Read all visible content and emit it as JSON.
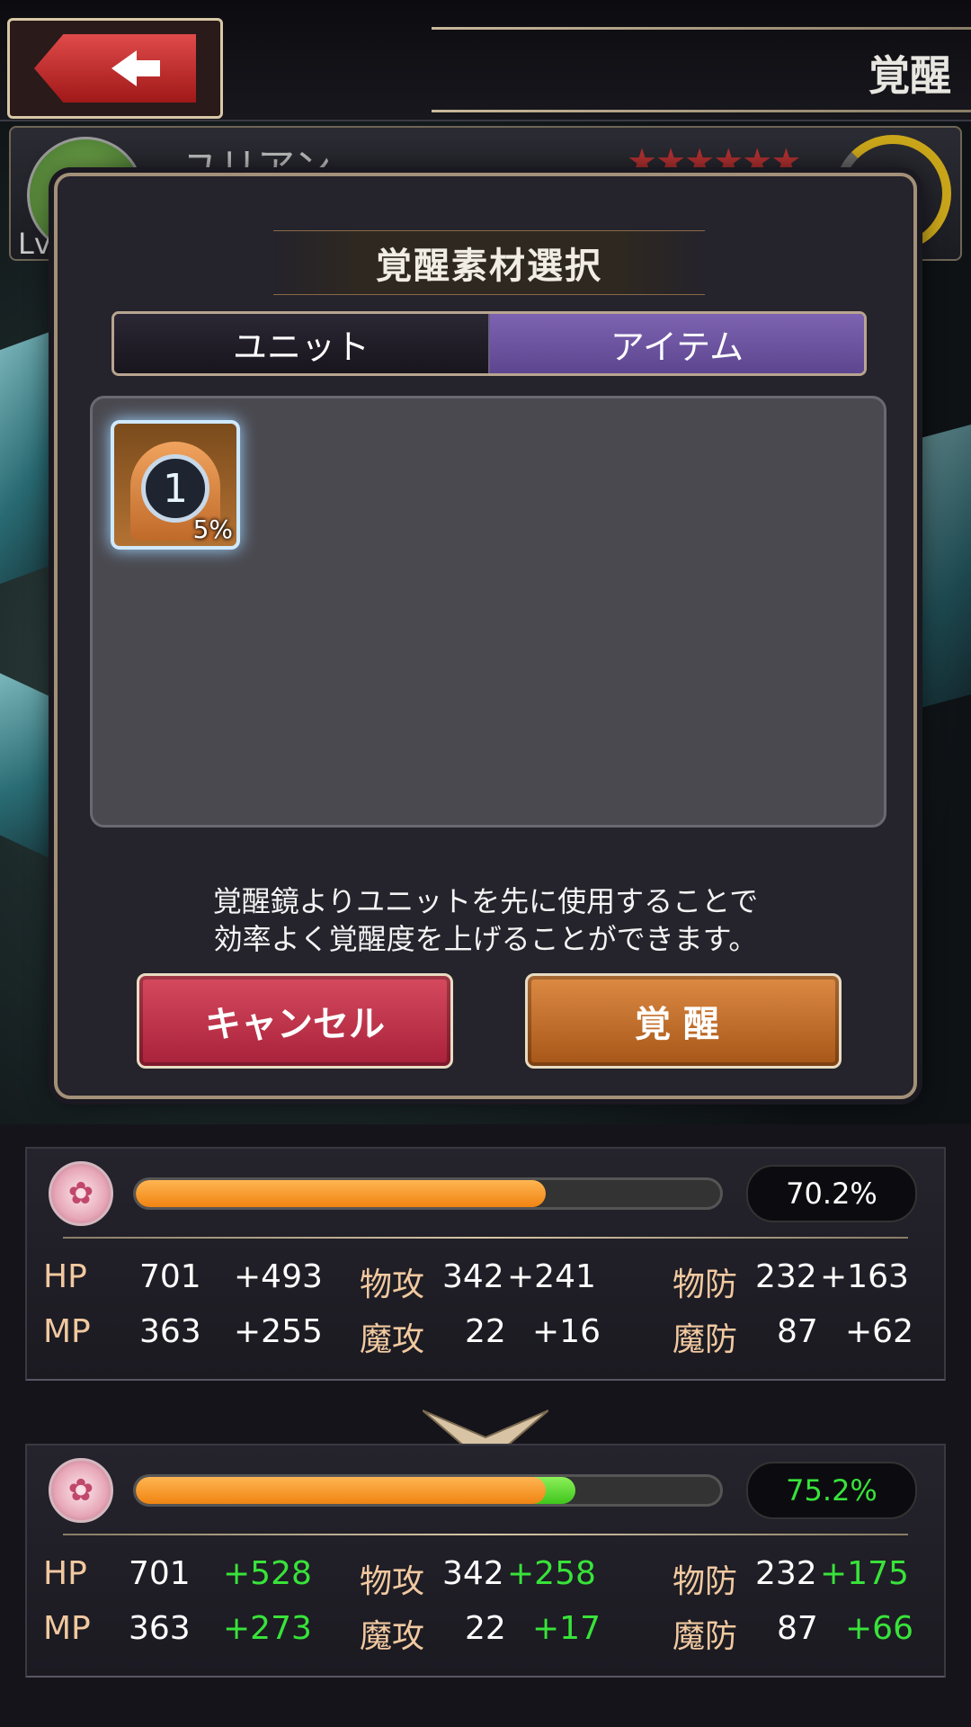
{
  "header": {
    "title": "覚醒"
  },
  "unit": {
    "name": "ユリアン",
    "stars": "★★★★★★",
    "lv_prefix": "Lv"
  },
  "dialog": {
    "title": "覚醒素材選択",
    "tabs": [
      {
        "label": "ユニット",
        "selected": false
      },
      {
        "label": "アイテム",
        "selected": true
      }
    ],
    "items": [
      {
        "icon": "awakening-mirror-icon",
        "count": "1",
        "rate": "5%"
      }
    ],
    "notice_line1": "覚醒鏡よりユニットを先に使用することで",
    "notice_line2": "効率よく覚醒度を上げることができます。",
    "cancel_label": "キャンセル",
    "awaken_label": "覚醒"
  },
  "before": {
    "progress": 70.2,
    "percent_text": "70.2%",
    "rows": [
      {
        "l1": "HP",
        "v1": "701",
        "b1": "+493",
        "l2": "物攻",
        "v2": "342",
        "b2": "+241",
        "l3": "物防",
        "v3": "232",
        "b3": "+163"
      },
      {
        "l1": "MP",
        "v1": "363",
        "b1": "+255",
        "l2": "魔攻",
        "v2": "22",
        "b2": "+16",
        "l3": "魔防",
        "v3": "87",
        "b3": "+62"
      }
    ]
  },
  "after": {
    "progress": 75.2,
    "percent_text": "75.2%",
    "rows": [
      {
        "l1": "HP",
        "v1": "701",
        "b1": "+528",
        "l2": "物攻",
        "v2": "342",
        "b2": "+258",
        "l3": "物防",
        "v3": "232",
        "b3": "+175"
      },
      {
        "l1": "MP",
        "v1": "363",
        "b1": "+273",
        "l2": "魔攻",
        "v2": "22",
        "b2": "+17",
        "l3": "魔防",
        "v3": "87",
        "b3": "+66"
      }
    ]
  },
  "colors": {
    "accent_purple": "#6a51a0",
    "cancel_red": "#c0334a",
    "awaken_orange": "#c6722c",
    "gain_green": "#38e33a",
    "gauge_orange": "#f5982a"
  }
}
